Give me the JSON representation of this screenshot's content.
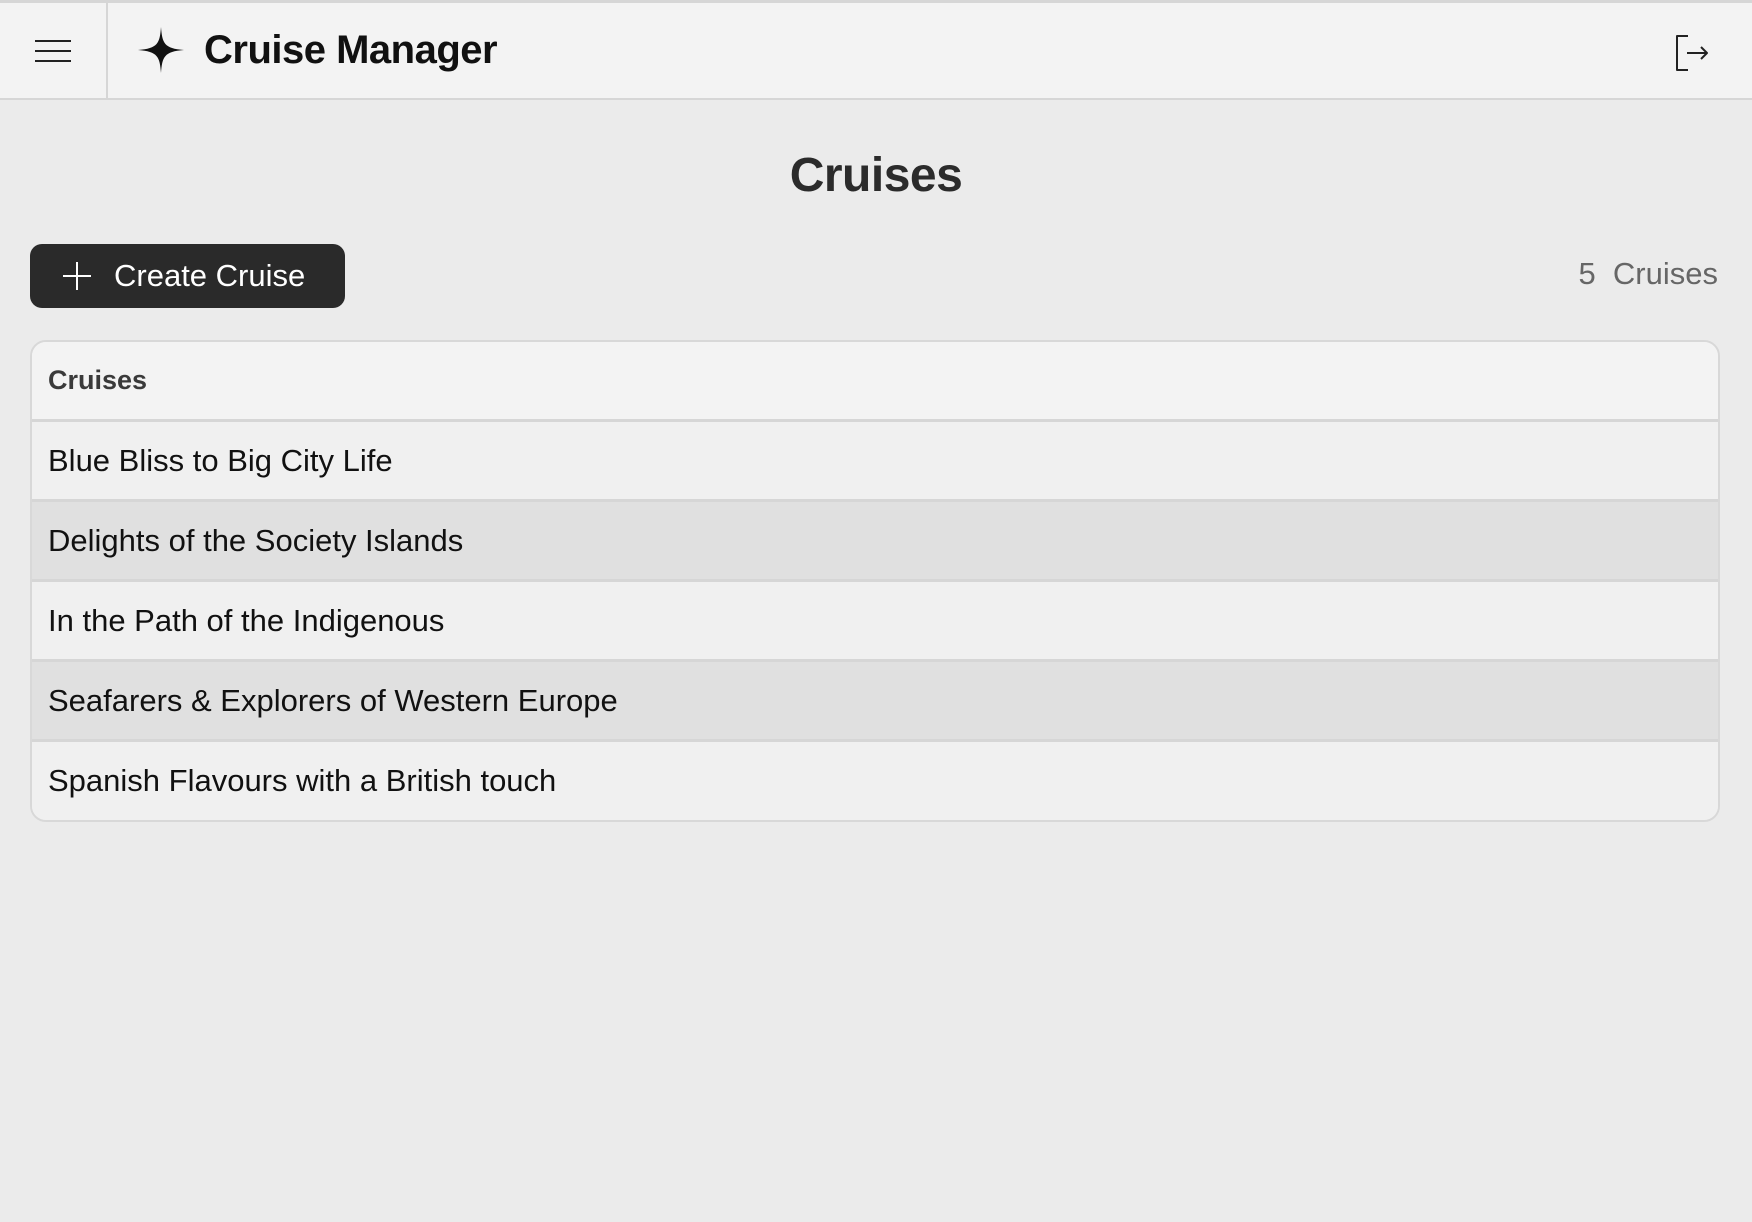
{
  "header": {
    "app_title": "Cruise Manager",
    "menu_icon": "hamburger-menu-icon",
    "brand_icon": "sparkle-star-icon",
    "logout_icon": "logout-icon"
  },
  "page": {
    "title": "Cruises"
  },
  "toolbar": {
    "create_label": "Create Cruise",
    "create_icon": "plus-icon",
    "count_label": "5  Cruises"
  },
  "table": {
    "header": "Cruises",
    "rows": [
      "Blue Bliss to Big City Life",
      "Delights of the Society Islands",
      "In the Path of the Indigenous",
      "Seafarers & Explorers of Western Europe",
      "Spanish Flavours with a British touch"
    ]
  },
  "colors": {
    "background": "#ebebeb",
    "topbar": "#f3f3f3",
    "primary_button": "#2a2a2a",
    "row_alt": "#e0e0e0",
    "row": "#f0f0f0",
    "border": "#d6d6d6"
  }
}
